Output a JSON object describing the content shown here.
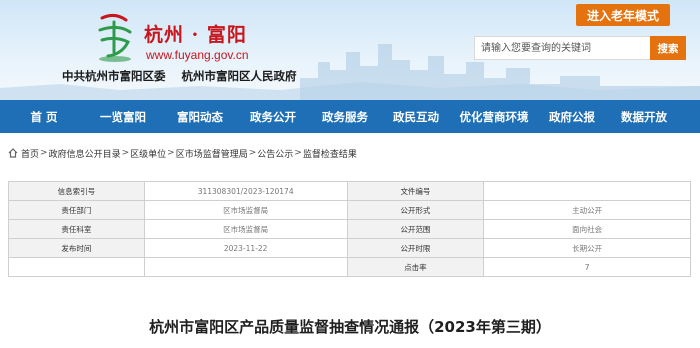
{
  "header": {
    "logo_name": "杭州 · 富阳",
    "logo_url": "www.fuyang.gov.cn",
    "org_names": [
      "中共杭州市富阳区委",
      "杭州市富阳区人民政府"
    ],
    "elder_mode_label": "进入老年模式",
    "search": {
      "placeholder": "请输入您要查询的关键词",
      "button_label": "搜索"
    }
  },
  "nav": {
    "items": [
      "首 页",
      "一览富阳",
      "富阳动态",
      "政务公开",
      "政务服务",
      "政民互动",
      "优化营商环境",
      "政府公报",
      "数据开放"
    ]
  },
  "breadcrumb": {
    "items": [
      "首页",
      "政府信息公开目录",
      "区级单位",
      "区市场监督管理局",
      "公告公示",
      "监督检查结果"
    ],
    "separator": ">"
  },
  "info_table": {
    "rows": [
      {
        "label1": "信息索引号",
        "value1": "311308301/2023-120174",
        "label2": "文件编号",
        "value2": ""
      },
      {
        "label1": "责任部门",
        "value1": "区市场监督局",
        "label2": "公开形式",
        "value2": "主动公开"
      },
      {
        "label1": "责任科室",
        "value1": "区市场监督局",
        "label2": "公开范围",
        "value2": "面向社会"
      },
      {
        "label1": "发布时间",
        "value1": "2023-11-22",
        "label2": "公开时限",
        "value2": "长期公开"
      },
      {
        "label1": "",
        "value1": "",
        "label2": "点击率",
        "value2": "7"
      }
    ]
  },
  "article": {
    "title": "杭州市富阳区产品质量监督抽查情况通报（2023年第三期）"
  },
  "colors": {
    "nav_blue": "#1f6fb7",
    "accent_orange": "#e4720f",
    "brand_red": "#c8161d"
  }
}
